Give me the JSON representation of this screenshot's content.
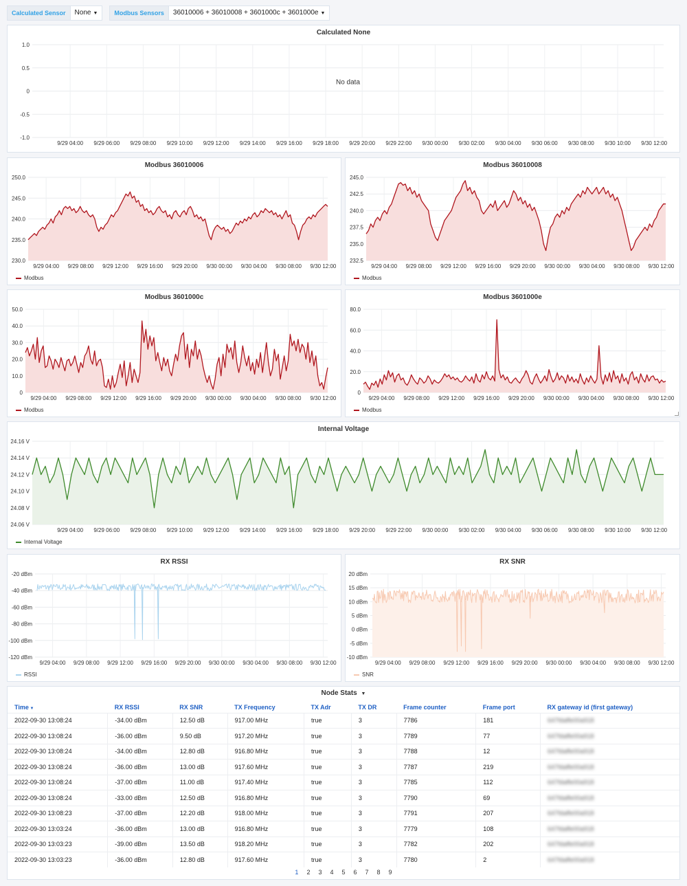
{
  "variables": {
    "calculated_label": "Calculated Sensor",
    "calculated_value": "None",
    "modbus_label": "Modbus Sensors",
    "modbus_value": "36010006 + 36010008 + 3601000c + 3601000e"
  },
  "colors": {
    "modbus": "#b0161e",
    "modbus_fill": "#f8dedd",
    "voltage": "#3f8a2c",
    "voltage_fill": "#eaf2e8",
    "rssi": "#a9d3ee",
    "snr": "#f7c9b1",
    "link": "#1f60c4"
  },
  "chart_data": [
    {
      "id": "calculated",
      "type": "line",
      "title": "Calculated None",
      "no_data": "No data",
      "yticks": [
        "1.0",
        "0.5",
        "0",
        "-0.5",
        "-1.0"
      ],
      "ylim": [
        -1.0,
        1.0
      ],
      "xticks": [
        "9/29 04:00",
        "9/29 06:00",
        "9/29 08:00",
        "9/29 10:00",
        "9/29 12:00",
        "9/29 14:00",
        "9/29 16:00",
        "9/29 18:00",
        "9/29 20:00",
        "9/29 22:00",
        "9/30 00:00",
        "9/30 02:00",
        "9/30 04:00",
        "9/30 06:00",
        "9/30 08:00",
        "9/30 10:00",
        "9/30 12:00"
      ],
      "series": []
    },
    {
      "id": "m06",
      "type": "area",
      "title": "Modbus 36010006",
      "legend": "Modbus",
      "yticks": [
        "250.0",
        "245.0",
        "240.0",
        "235.0",
        "230.0"
      ],
      "ylim": [
        230,
        250
      ],
      "xticks": [
        "9/29 04:00",
        "9/29 08:00",
        "9/29 12:00",
        "9/29 16:00",
        "9/29 20:00",
        "9/30 00:00",
        "9/30 04:00",
        "9/30 08:00",
        "9/30 12:00"
      ],
      "values": [
        235,
        235.5,
        236,
        236.5,
        236,
        237,
        237.5,
        238,
        237.5,
        238.5,
        239,
        240,
        239,
        240.5,
        241,
        242,
        241,
        242.5,
        243,
        242.5,
        243,
        242,
        242.5,
        241.5,
        242,
        243,
        242,
        241.5,
        242,
        241,
        240.5,
        241,
        240,
        238,
        237,
        238,
        237.5,
        238.5,
        239,
        240,
        241,
        240.5,
        241.5,
        242,
        243,
        244,
        245,
        246,
        245.5,
        246.5,
        245,
        245.5,
        244,
        244.5,
        243,
        243.5,
        242,
        242.5,
        241.5,
        242,
        241,
        241.5,
        242.5,
        243,
        242,
        241.5,
        242,
        240.5,
        241,
        240,
        241.5,
        242,
        241,
        240.5,
        241.5,
        242,
        241,
        242.5,
        243,
        242,
        240.5,
        241,
        240,
        240.5,
        239.5,
        240,
        238,
        236,
        235,
        237,
        238,
        238.5,
        238,
        237.5,
        238,
        237,
        237.5,
        236.5,
        237,
        238,
        239,
        238.5,
        239.5,
        239,
        240,
        239.5,
        240.5,
        240,
        241,
        241.5,
        240.5,
        241,
        242,
        241.5,
        242.5,
        242,
        241.5,
        242,
        241,
        241.5,
        240.5,
        241,
        240,
        241,
        242,
        240.5,
        241,
        239,
        238.5,
        237,
        235,
        237,
        238.5,
        239,
        240,
        240.5,
        240,
        241,
        240.5,
        241.5,
        242,
        242.5,
        243,
        243.5,
        243
      ]
    },
    {
      "id": "m08",
      "type": "area",
      "title": "Modbus 36010008",
      "legend": "Modbus",
      "yticks": [
        "245.0",
        "242.5",
        "240.0",
        "237.5",
        "235.0",
        "232.5"
      ],
      "ylim": [
        232.5,
        245.0
      ],
      "xticks": [
        "9/29 04:00",
        "9/29 08:00",
        "9/29 12:00",
        "9/29 16:00",
        "9/29 20:00",
        "9/30 00:00",
        "9/30 04:00",
        "9/30 08:00",
        "9/30 12:00"
      ],
      "values": [
        236.5,
        237,
        238,
        237.5,
        238.5,
        239,
        238.5,
        239.5,
        240,
        239.5,
        240.5,
        241,
        242,
        243,
        244,
        244.2,
        243.8,
        244,
        243,
        243.5,
        242.5,
        243,
        242,
        242.5,
        241.5,
        241,
        240.5,
        240,
        238,
        237,
        236,
        235.5,
        236.5,
        237.5,
        238.5,
        239,
        239.5,
        240,
        241,
        242,
        242.5,
        243,
        244,
        244.5,
        243,
        243.5,
        242.5,
        243,
        242,
        241.5,
        240,
        239.5,
        240,
        240.5,
        241,
        240.5,
        241.5,
        240,
        240.5,
        241,
        241.5,
        240.5,
        241,
        242,
        243,
        242.5,
        241.5,
        242,
        241,
        241.5,
        240.5,
        241,
        240,
        240.5,
        239.5,
        238.5,
        237,
        235,
        234,
        236,
        237.5,
        238,
        239,
        239.5,
        239,
        240,
        239.5,
        240.5,
        240,
        241,
        241.5,
        242,
        242.5,
        242,
        243,
        242.5,
        243.5,
        243,
        242.5,
        243,
        243.5,
        242.5,
        243,
        243.5,
        242.5,
        243,
        242,
        242.5,
        241.5,
        242,
        241,
        240,
        238.5,
        237,
        235.5,
        234,
        234.5,
        235.5,
        236,
        236.5,
        237,
        237.5,
        237,
        238,
        237.5,
        238.5,
        239,
        240,
        240.5,
        241,
        241
      ]
    },
    {
      "id": "m0c",
      "type": "area",
      "title": "Modbus 3601000c",
      "legend": "Modbus",
      "yticks": [
        "50.0",
        "40.0",
        "30.0",
        "20.0",
        "10.0",
        "0"
      ],
      "ylim": [
        0,
        50
      ],
      "xticks": [
        "9/29 04:00",
        "9/29 08:00",
        "9/29 12:00",
        "9/29 16:00",
        "9/29 20:00",
        "9/30 00:00",
        "9/30 04:00",
        "9/30 08:00",
        "9/30 12:00"
      ],
      "values": [
        24,
        27,
        22,
        25,
        29,
        20,
        33,
        18,
        25,
        28,
        15,
        16,
        22,
        19,
        14,
        20,
        18,
        15,
        21,
        17,
        13,
        19,
        20,
        16,
        18,
        22,
        17,
        12,
        18,
        15,
        22,
        24,
        28,
        20,
        17,
        25,
        16,
        19,
        20,
        15,
        4,
        3,
        8,
        2,
        10,
        3,
        6,
        12,
        17,
        9,
        19,
        4,
        10,
        18,
        6,
        14,
        10,
        6,
        12,
        43,
        30,
        38,
        26,
        34,
        28,
        33,
        19,
        24,
        18,
        13,
        21,
        16,
        20,
        13,
        10,
        17,
        23,
        19,
        28,
        34,
        36,
        20,
        29,
        15,
        26,
        22,
        31,
        20,
        26,
        22,
        15,
        10,
        6,
        10,
        5,
        2,
        8,
        17,
        21,
        10,
        23,
        15,
        29,
        24,
        27,
        20,
        31,
        18,
        12,
        18,
        28,
        21,
        16,
        22,
        13,
        18,
        11,
        20,
        15,
        24,
        12,
        21,
        30,
        18,
        10,
        14,
        26,
        19,
        23,
        8,
        15,
        22,
        13,
        19,
        35,
        28,
        31,
        25,
        32,
        24,
        29,
        27,
        20,
        30,
        18,
        25,
        16,
        22,
        10,
        4,
        6,
        2,
        9,
        15
      ]
    },
    {
      "id": "m0e",
      "type": "area",
      "title": "Modbus 3601000e",
      "legend": "Modbus",
      "yticks": [
        "80.0",
        "60.0",
        "40.0",
        "20.0",
        "0"
      ],
      "ylim": [
        0,
        80
      ],
      "xticks": [
        "9/29 04:00",
        "9/29 08:00",
        "9/29 12:00",
        "9/29 16:00",
        "9/29 20:00",
        "9/30 00:00",
        "9/30 04:00",
        "9/30 08:00",
        "9/30 12:00"
      ],
      "values": [
        8,
        10,
        6,
        3,
        9,
        7,
        11,
        5,
        13,
        8,
        17,
        12,
        21,
        15,
        19,
        10,
        16,
        18,
        12,
        14,
        9,
        7,
        11,
        17,
        13,
        10,
        8,
        14,
        12,
        9,
        11,
        16,
        13,
        8,
        12,
        10,
        9,
        11,
        14,
        18,
        15,
        17,
        13,
        15,
        12,
        14,
        11,
        10,
        12,
        16,
        13,
        11,
        15,
        9,
        18,
        12,
        10,
        17,
        13,
        20,
        14,
        12,
        16,
        11,
        70,
        22,
        14,
        17,
        12,
        15,
        10,
        9,
        12,
        14,
        11,
        9,
        13,
        16,
        21,
        17,
        10,
        8,
        14,
        18,
        13,
        9,
        12,
        16,
        11,
        22,
        15,
        10,
        13,
        19,
        12,
        16,
        14,
        9,
        17,
        11,
        15,
        10,
        13,
        9,
        18,
        12,
        8,
        14,
        10,
        16,
        12,
        9,
        13,
        45,
        15,
        8,
        17,
        11,
        19,
        10,
        21,
        13,
        16,
        9,
        18,
        11,
        14,
        8,
        17,
        20,
        12,
        15,
        9,
        18,
        13,
        10,
        17,
        11,
        15,
        16,
        12,
        13,
        9,
        12,
        10,
        11
      ]
    },
    {
      "id": "voltage",
      "type": "area",
      "title": "Internal Voltage",
      "legend": "Internal Voltage",
      "yticks": [
        "24.16 V",
        "24.14 V",
        "24.12 V",
        "24.10 V",
        "24.08 V",
        "24.06 V"
      ],
      "ylim": [
        24.06,
        24.16
      ],
      "xticks": [
        "9/29 04:00",
        "9/29 06:00",
        "9/29 08:00",
        "9/29 10:00",
        "9/29 12:00",
        "9/29 14:00",
        "9/29 16:00",
        "9/29 18:00",
        "9/29 20:00",
        "9/29 22:00",
        "9/30 00:00",
        "9/30 02:00",
        "9/30 04:00",
        "9/30 06:00",
        "9/30 08:00",
        "9/30 10:00",
        "9/30 12:00"
      ],
      "values": [
        24.12,
        24.14,
        24.12,
        24.13,
        24.11,
        24.12,
        24.14,
        24.12,
        24.09,
        24.12,
        24.14,
        24.13,
        24.12,
        24.14,
        24.12,
        24.11,
        24.13,
        24.14,
        24.12,
        24.14,
        24.13,
        24.12,
        24.11,
        24.14,
        24.12,
        24.13,
        24.14,
        24.12,
        24.08,
        24.12,
        24.14,
        24.12,
        24.11,
        24.13,
        24.12,
        24.14,
        24.11,
        24.12,
        24.13,
        24.12,
        24.14,
        24.12,
        24.11,
        24.12,
        24.13,
        24.14,
        24.12,
        24.09,
        24.12,
        24.13,
        24.14,
        24.11,
        24.12,
        24.14,
        24.13,
        24.12,
        24.11,
        24.14,
        24.12,
        24.13,
        24.08,
        24.12,
        24.13,
        24.14,
        24.12,
        24.11,
        24.13,
        24.12,
        24.14,
        24.12,
        24.1,
        24.12,
        24.13,
        24.12,
        24.11,
        24.12,
        24.14,
        24.12,
        24.1,
        24.12,
        24.13,
        24.12,
        24.11,
        24.12,
        24.14,
        24.12,
        24.1,
        24.12,
        24.13,
        24.11,
        24.12,
        24.14,
        24.12,
        24.13,
        24.12,
        24.11,
        24.14,
        24.12,
        24.13,
        24.12,
        24.14,
        24.11,
        24.12,
        24.13,
        24.15,
        24.12,
        24.11,
        24.14,
        24.12,
        24.13,
        24.12,
        24.14,
        24.11,
        24.12,
        24.13,
        24.14,
        24.12,
        24.1,
        24.12,
        24.14,
        24.13,
        24.12,
        24.11,
        24.14,
        24.12,
        24.15,
        24.12,
        24.11,
        24.13,
        24.14,
        24.12,
        24.1,
        24.12,
        24.14,
        24.13,
        24.12,
        24.11,
        24.13,
        24.14,
        24.12,
        24.1,
        24.12,
        24.14,
        24.12,
        24.12,
        24.12
      ]
    },
    {
      "id": "rssi",
      "type": "line",
      "title": "RX RSSI",
      "legend": "RSSI",
      "yticks": [
        "-20 dBm",
        "-40 dBm",
        "-60 dBm",
        "-80 dBm",
        "-100 dBm",
        "-120 dBm"
      ],
      "ylim": [
        -120,
        -20
      ],
      "xticks": [
        "9/29 04:00",
        "9/29 08:00",
        "9/29 12:00",
        "9/29 16:00",
        "9/29 20:00",
        "9/30 00:00",
        "9/30 04:00",
        "9/30 08:00",
        "9/30 12:00"
      ],
      "baseline": -36,
      "noise": 4,
      "spikes": [
        [
          0.34,
          -98
        ],
        [
          0.37,
          -99
        ],
        [
          0.43,
          -98
        ]
      ]
    },
    {
      "id": "snr",
      "type": "line",
      "title": "RX SNR",
      "legend": "SNR",
      "yticks": [
        "20 dBm",
        "15 dBm",
        "10 dBm",
        "5 dBm",
        "0 dBm",
        "-5 dBm",
        "-10 dBm"
      ],
      "ylim": [
        -10,
        20
      ],
      "xticks": [
        "9/29 04:00",
        "9/29 08:00",
        "9/29 12:00",
        "9/29 16:00",
        "9/29 20:00",
        "9/30 00:00",
        "9/30 04:00",
        "9/30 08:00",
        "9/30 12:00"
      ],
      "baseline": 12,
      "noise": 2.5,
      "spikes": [
        [
          0.29,
          -8
        ],
        [
          0.31,
          -6
        ],
        [
          0.33,
          -8
        ],
        [
          0.39,
          -7
        ],
        [
          0.56,
          4
        ],
        [
          0.82,
          6
        ]
      ]
    }
  ],
  "table": {
    "title": "Node Stats",
    "columns": [
      "Time",
      "RX RSSI",
      "RX SNR",
      "TX Frequency",
      "TX Adr",
      "TX DR",
      "Frame counter",
      "Frame port",
      "RX gateway id (first gateway)"
    ],
    "rows": [
      [
        "2022-09-30 13:08:24",
        "-34.00 dBm",
        "12.50 dB",
        "917.00 MHz",
        "true",
        "3",
        "7786",
        "181",
        "647fdaffe00a918"
      ],
      [
        "2022-09-30 13:08:24",
        "-36.00 dBm",
        "9.50 dB",
        "917.20 MHz",
        "true",
        "3",
        "7789",
        "77",
        "647fdaffe00a918"
      ],
      [
        "2022-09-30 13:08:24",
        "-34.00 dBm",
        "12.80 dB",
        "916.80 MHz",
        "true",
        "3",
        "7788",
        "12",
        "647fdaffe00a918"
      ],
      [
        "2022-09-30 13:08:24",
        "-36.00 dBm",
        "13.00 dB",
        "917.60 MHz",
        "true",
        "3",
        "7787",
        "219",
        "647fdaffe00a918"
      ],
      [
        "2022-09-30 13:08:24",
        "-37.00 dBm",
        "11.00 dB",
        "917.40 MHz",
        "true",
        "3",
        "7785",
        "112",
        "647fdaffe00a918"
      ],
      [
        "2022-09-30 13:08:24",
        "-33.00 dBm",
        "12.50 dB",
        "916.80 MHz",
        "true",
        "3",
        "7790",
        "69",
        "647fdaffe00a918"
      ],
      [
        "2022-09-30 13:08:23",
        "-37.00 dBm",
        "12.20 dB",
        "918.00 MHz",
        "true",
        "3",
        "7791",
        "207",
        "647fdaffe00a918"
      ],
      [
        "2022-09-30 13:03:24",
        "-36.00 dBm",
        "13.00 dB",
        "916.80 MHz",
        "true",
        "3",
        "7779",
        "108",
        "647fdaffe00a918"
      ],
      [
        "2022-09-30 13:03:23",
        "-39.00 dBm",
        "13.50 dB",
        "918.20 MHz",
        "true",
        "3",
        "7782",
        "202",
        "647fdaffe00a918"
      ],
      [
        "2022-09-30 13:03:23",
        "-36.00 dBm",
        "12.80 dB",
        "917.60 MHz",
        "true",
        "3",
        "7780",
        "2",
        "647fdaffe00a918"
      ]
    ],
    "pages": [
      "1",
      "2",
      "3",
      "4",
      "5",
      "6",
      "7",
      "8",
      "9"
    ],
    "active_page": "1"
  }
}
